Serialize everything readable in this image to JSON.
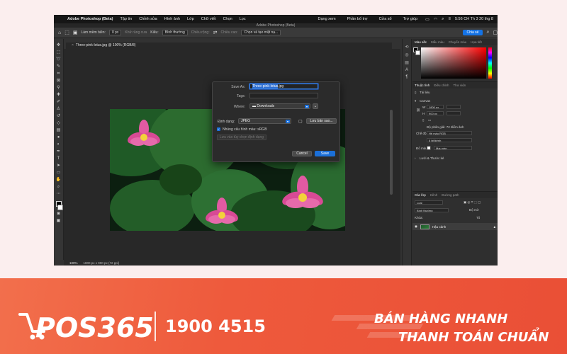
{
  "menubar": {
    "app": "Adobe Photoshop (Beta)",
    "items": [
      "Tập tin",
      "Chỉnh sửa",
      "Hình ảnh",
      "Lớp",
      "Chữ viết",
      "Chọn",
      "Lọc"
    ],
    "right_items": [
      "Dạng xem",
      "Phần bổ trợ",
      "Cửa sổ",
      "Trợ giúp"
    ],
    "clock": "5:56 CH Th 3 20 thg 8"
  },
  "window_title": "Adobe Photoshop (Beta)",
  "optionsbar": {
    "feather_label": "Làm mềm biên:",
    "feather_value": "0 px",
    "antialias": "Khử răng cưa",
    "style_label": "Kiểu:",
    "style_value": "Bình thường",
    "width_label": "Chiều rộng:",
    "height_label": "Chiều cao:",
    "select_mask": "Chọn và tạo mặt nạ...",
    "share_label": "Chia sẻ"
  },
  "document": {
    "tab_title": "Three-pink-lotus.jpg @ 100% (RGB/8)"
  },
  "statusbar": {
    "zoom": "100%",
    "info": "1800 px x 900 px (72 ppi)"
  },
  "dialog": {
    "save_as_label": "Save As:",
    "filename_base": "Three-pink-lotus",
    "filename_ext": ".jpg",
    "tags_label": "Tags:",
    "where_label": "Where:",
    "where_value": "Downloads",
    "format_label": "Định dạng:",
    "format_value": "JPEG",
    "save_copy": "Lưu bản sao...",
    "embed_profile": "Nhúng cấu hình màu: sRGB",
    "save_ext_prefs": "Lưu vào tùy chọn định dạng",
    "cancel": "Cancel",
    "save": "Save"
  },
  "panels": {
    "color_tabs": [
      "Màu sắc",
      "Mẫu màu",
      "Chuyển màu",
      "Họa tiết"
    ],
    "props_tabs": [
      "Thuộc tính",
      "Điều chỉnh",
      "Thư viện"
    ],
    "doc_label": "Tài liệu",
    "canvas_label": "Canvas",
    "w_label": "W",
    "w_value": "1800 px",
    "h_label": "H",
    "h_value": "900 px",
    "resolution": "Độ phân giải: 72 điểm ảnh",
    "mode_label": "Chế độ",
    "mode_value": "Hệ màu RGB",
    "depth_value": "8 bit/kênh",
    "fill_label": "Đổ màu",
    "fill_value": "Màu nền",
    "rulers_label": "Lưới & Thước kẻ",
    "layer_tabs": [
      "Các lớp",
      "Kênh",
      "Đường path"
    ],
    "search_placeholder": "Loại",
    "blend_placeholder": "Bình thường",
    "opacity_label": "Độ mờ",
    "lock_label": "Khóa:",
    "fill_layer_label": "Tô",
    "layer_name": "Hậu cảnh"
  },
  "banner": {
    "logo": "POS365",
    "phone": "1900 4515",
    "slogan_1": "BÁN HÀNG NHANH",
    "slogan_2": "THANH TOÁN CHUẨN"
  },
  "colors": {
    "accent_blue": "#1b6fd8",
    "banner_orange": "#ee5a3c",
    "ps_background": "#323232"
  }
}
